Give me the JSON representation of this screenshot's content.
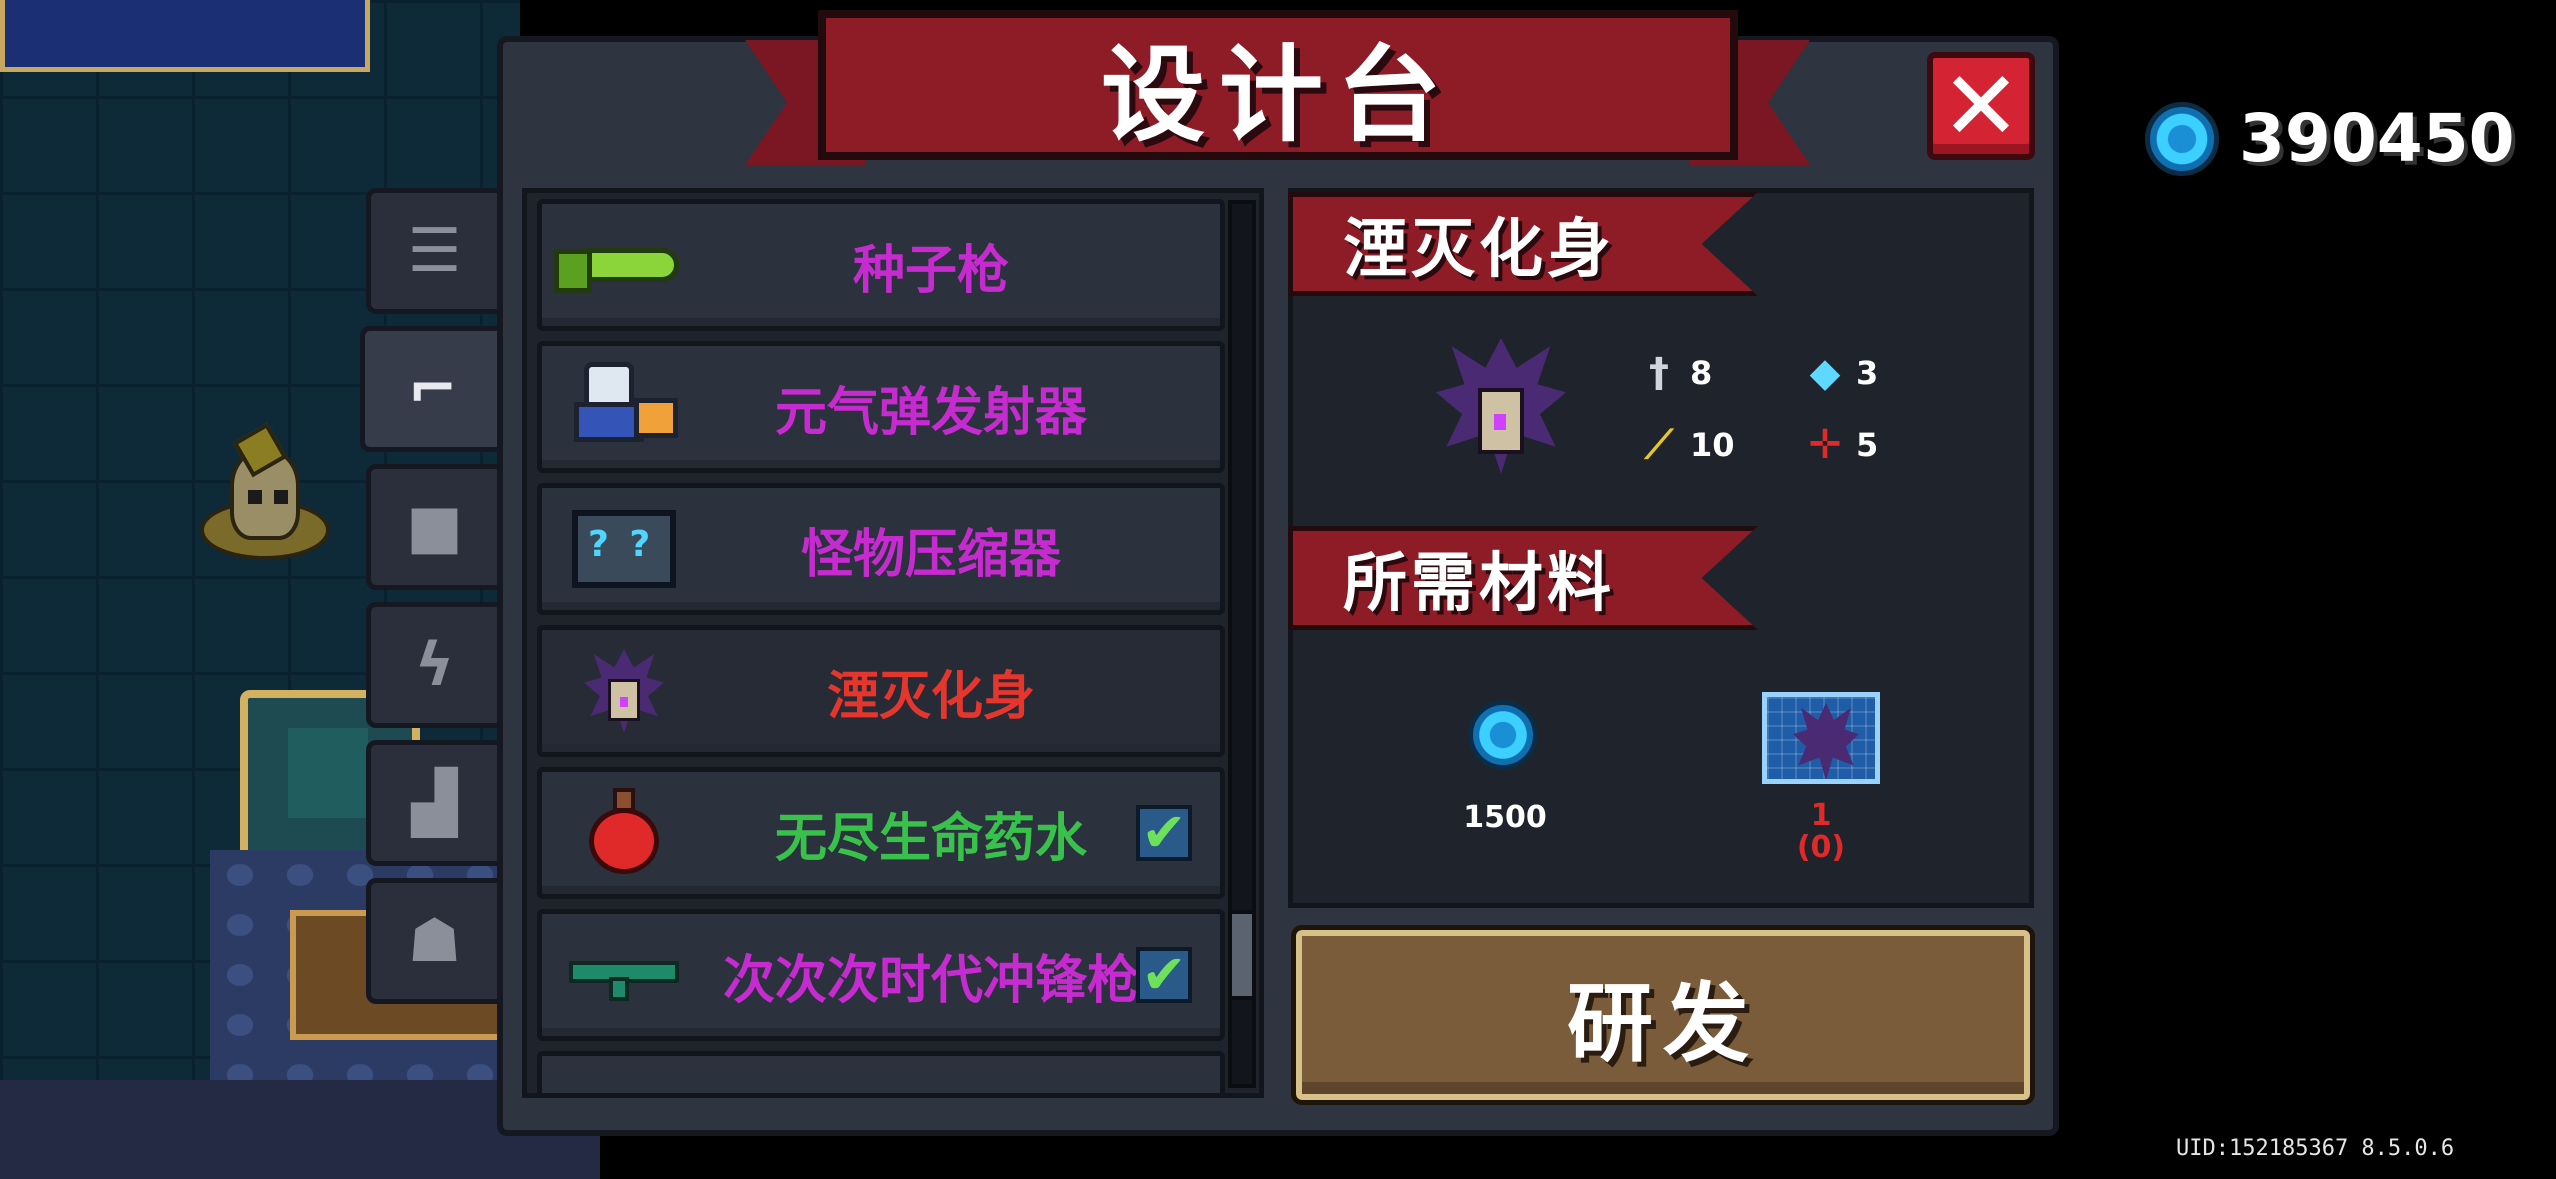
{
  "title": "设计台",
  "close_label": "✕",
  "currency": {
    "icon": "gem-icon",
    "amount": "390450"
  },
  "uid": "UID:152185367 8.5.0.6",
  "tabs": [
    {
      "name": "list",
      "icon": "☰",
      "active": false
    },
    {
      "name": "weapons",
      "icon": "⌐",
      "active": true
    },
    {
      "name": "armor",
      "icon": "■",
      "active": false
    },
    {
      "name": "skills",
      "icon": "ϟ",
      "active": false
    },
    {
      "name": "items",
      "icon": "▟",
      "active": false
    },
    {
      "name": "characters",
      "icon": "☗",
      "active": false
    }
  ],
  "items": [
    {
      "name": "种子枪",
      "color": "purple",
      "checked": false
    },
    {
      "name": "元气弹发射器",
      "color": "purple",
      "checked": false
    },
    {
      "name": "怪物压缩器",
      "color": "purple",
      "checked": false
    },
    {
      "name": "湮灭化身",
      "color": "red",
      "checked": false
    },
    {
      "name": "无尽生命药水",
      "color": "green",
      "checked": true
    },
    {
      "name": "次次次时代冲锋枪",
      "color": "purple",
      "checked": true
    }
  ],
  "detail": {
    "name": "湮灭化身",
    "stats": {
      "damage": "8",
      "energy": "3",
      "crit": "10",
      "accuracy": "5"
    },
    "materials_label": "所需材料",
    "materials": [
      {
        "icon": "gem-icon",
        "value": "1500"
      },
      {
        "icon": "blueprint-icon",
        "value": "1",
        "owned": "(0)"
      }
    ]
  },
  "research_button": "研发"
}
